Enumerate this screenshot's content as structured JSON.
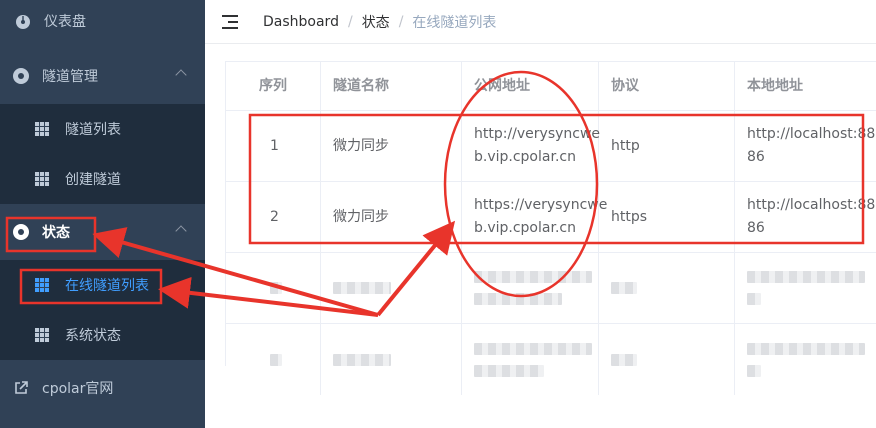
{
  "sidebar": {
    "items": [
      {
        "label": "仪表盘",
        "icon": "dashboard-icon"
      },
      {
        "label": "隧道管理",
        "icon": "tunnel-manage-icon"
      },
      {
        "label": "隧道列表",
        "icon": "grid-icon"
      },
      {
        "label": "创建隧道",
        "icon": "grid-icon"
      },
      {
        "label": "状态",
        "icon": "status-icon"
      },
      {
        "label": "在线隧道列表",
        "icon": "grid-icon"
      },
      {
        "label": "系统状态",
        "icon": "grid-icon"
      },
      {
        "label": "cpolar官网",
        "icon": "external-link-icon"
      }
    ]
  },
  "header": {
    "breadcrumb": [
      "Dashboard",
      "状态",
      "在线隧道列表"
    ]
  },
  "table": {
    "columns": [
      "序列",
      "隧道名称",
      "公网地址",
      "协议",
      "本地地址"
    ],
    "rows": [
      {
        "index": "1",
        "name": "微力同步",
        "url_line1": "http://verysyncwe",
        "url_line2": "b.vip.cpolar.cn",
        "protocol": "http",
        "local_line1": "http://localhost:88",
        "local_line2": "86"
      },
      {
        "index": "2",
        "name": "微力同步",
        "url_line1": "https://verysyncwe",
        "url_line2": "b.vip.cpolar.cn",
        "protocol": "https",
        "local_line1": "http://localhost:88",
        "local_line2": "86"
      }
    ]
  },
  "colors": {
    "sidebar_bg": "#304156",
    "submenu_bg": "#1f2d3d",
    "active": "#409eff",
    "annotation": "#e8342b"
  }
}
